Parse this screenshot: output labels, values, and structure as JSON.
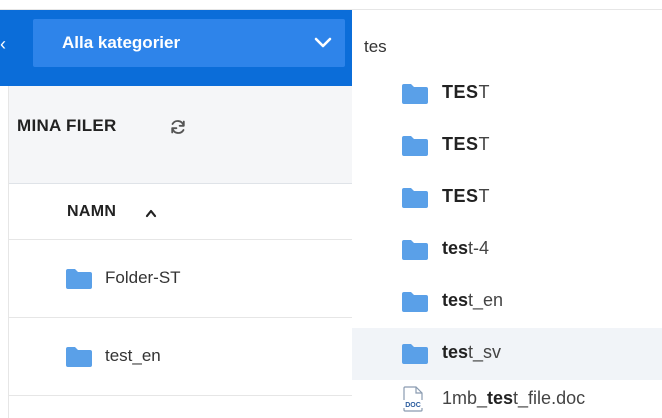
{
  "header": {
    "category_label": "Alla kategorier",
    "search_value": "tes"
  },
  "left": {
    "section_title": "MINA FILER",
    "column_name": "NAMN",
    "files": [
      {
        "name": "Folder-ST"
      },
      {
        "name": "test_en"
      }
    ]
  },
  "results": [
    {
      "bold": "TES",
      "rest": "T",
      "type": "folder"
    },
    {
      "bold": "TES",
      "rest": "T",
      "type": "folder"
    },
    {
      "bold": "TES",
      "rest": "T",
      "type": "folder"
    },
    {
      "bold": "tes",
      "rest": "t-4",
      "type": "folder"
    },
    {
      "bold": "tes",
      "rest": "t_en",
      "type": "folder"
    },
    {
      "bold": "tes",
      "rest": "t_sv",
      "type": "folder"
    },
    {
      "pre": "1mb_",
      "bold": "tes",
      "rest": "t_file.doc",
      "type": "doc"
    }
  ],
  "colors": {
    "brand_blue": "#0b6dd9",
    "select_blue": "#2e84ea",
    "folder_blue": "#5aa0e8"
  },
  "icons": {
    "folder": "folder-icon",
    "doc": "doc-file-icon",
    "refresh": "refresh-icon",
    "chevron": "chevron-down-icon"
  }
}
